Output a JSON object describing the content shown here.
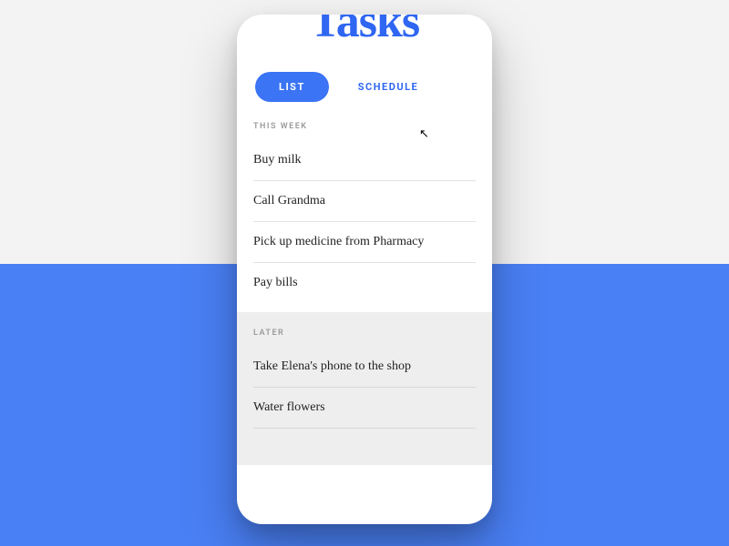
{
  "app": {
    "title": "Tasks"
  },
  "tabs": {
    "list": "List",
    "schedule": "Schedule"
  },
  "sections": {
    "thisWeek": {
      "header": "This Week",
      "items": [
        "Buy milk",
        "Call Grandma",
        "Pick up medicine from Pharmacy",
        "Pay bills"
      ]
    },
    "later": {
      "header": "Later",
      "items": [
        "Take Elena's phone to the shop",
        "Water flowers"
      ]
    }
  }
}
